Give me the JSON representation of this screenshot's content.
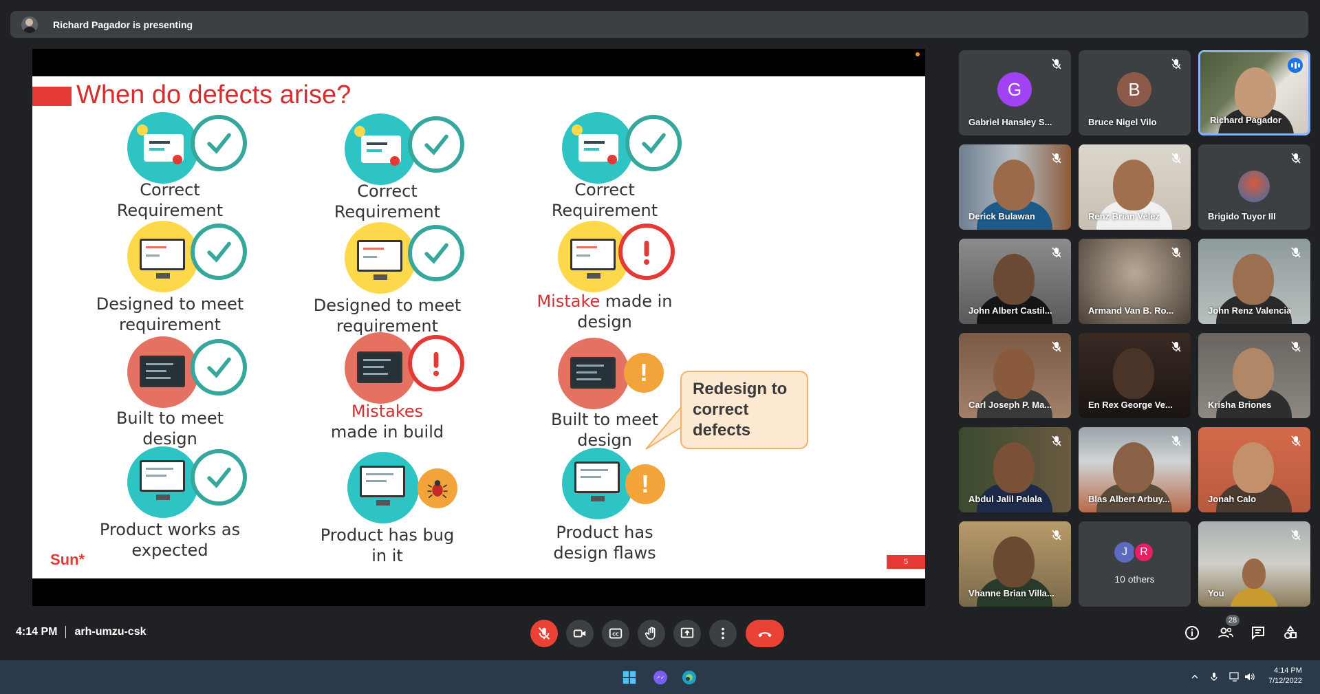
{
  "presenting_bar": {
    "text": "Richard Pagador is presenting"
  },
  "slide": {
    "title": "When do defects arise?",
    "columns": [
      {
        "requirement": {
          "line1": "Correct",
          "line2": "Requirement"
        },
        "design": {
          "line1": "Designed to meet",
          "line2": "requirement"
        },
        "build": {
          "line1": "Built to meet",
          "line2": "design"
        },
        "product": {
          "line1": "Product works as",
          "line2": "expected"
        }
      },
      {
        "requirement": {
          "line1": "Correct",
          "line2": "Requirement"
        },
        "design": {
          "line1": "Designed to meet",
          "line2": "requirement"
        },
        "build": {
          "line1_red": "Mistakes",
          "line2": "made in build"
        },
        "product": {
          "line1": "Product has bug",
          "line2": "in it"
        }
      },
      {
        "requirement": {
          "line1": "Correct",
          "line2": "Requirement"
        },
        "design": {
          "line1_red": "Mistake",
          "line1_rest": " made in",
          "line2": "design"
        },
        "build": {
          "line1": "Built to meet",
          "line2": "design"
        },
        "product": {
          "line1": "Product has",
          "line2": "design flaws"
        }
      }
    ],
    "callout": {
      "line1": "Redesign to",
      "line2": "correct",
      "line3": "defects"
    },
    "logo": "Sun*",
    "page_number": "5"
  },
  "participants": [
    {
      "name": "Gabriel Hansley S...",
      "letter": "G",
      "avatar_color": "#a142f4",
      "muted": true
    },
    {
      "name": "Bruce Nigel Vilo",
      "letter": "B",
      "avatar_color": "#8d5a4a",
      "muted": true
    },
    {
      "name": "Richard Pagador",
      "speaking": true
    },
    {
      "name": "Derick Bulawan",
      "muted": true
    },
    {
      "name": "Renz Brian Velez",
      "muted": true
    },
    {
      "name": "Brigido Tuyor III",
      "muted": true
    },
    {
      "name": "John Albert Castil...",
      "muted": true
    },
    {
      "name": "Armand Van B. Ro...",
      "muted": true
    },
    {
      "name": "John Renz Valencia",
      "muted": true
    },
    {
      "name": "Carl Joseph P. Ma...",
      "muted": true
    },
    {
      "name": "En Rex George Ve...",
      "muted": true
    },
    {
      "name": "Krisha Briones",
      "muted": true
    },
    {
      "name": "Abdul Jalil Palala",
      "muted": true
    },
    {
      "name": "Blas Albert Arbuy...",
      "muted": true
    },
    {
      "name": "Jonah Calo",
      "muted": true
    },
    {
      "name": "Vhanne Brian Villa...",
      "muted": true
    },
    {
      "others_label": "10 others",
      "others_letters": [
        "J",
        "R"
      ]
    },
    {
      "name": "You",
      "muted": true
    }
  ],
  "meeting": {
    "time": "4:14 PM",
    "code": "arh-umzu-csk"
  },
  "people_count": "28",
  "taskbar": {
    "time": "4:14 PM",
    "date": "7/12/2022"
  },
  "colors": {
    "accent": "#8ab4f8",
    "leave": "#ea4335",
    "mic_off_btn": "#ea4335"
  }
}
